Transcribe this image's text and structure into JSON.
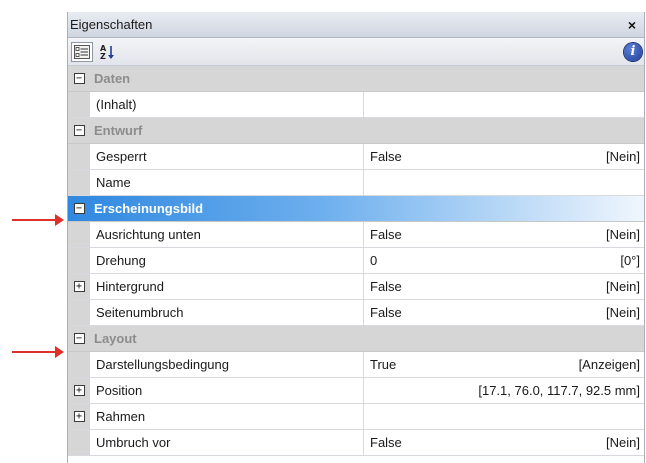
{
  "window": {
    "title": "Eigenschaften",
    "close_symbol": "×"
  },
  "toolbar": {
    "sort_alpha_glyph": "A↓Z",
    "info_glyph": "i"
  },
  "colors": {
    "selected_category": "#2f88e0",
    "arrow": "#e0302c",
    "category_bg": "#d6d6d6"
  },
  "rows": [
    {
      "type": "category",
      "label": "Daten",
      "expander": "−"
    },
    {
      "type": "prop",
      "name": "(Inhalt)",
      "value": "",
      "display": ""
    },
    {
      "type": "category",
      "label": "Entwurf",
      "expander": "−"
    },
    {
      "type": "prop",
      "name": "Gesperrt",
      "value": "False",
      "display": "[Nein]"
    },
    {
      "type": "prop",
      "name": "Name",
      "value": "",
      "display": ""
    },
    {
      "type": "category",
      "label": "Erscheinungsbild",
      "expander": "−",
      "selected": true
    },
    {
      "type": "prop",
      "name": "Ausrichtung unten",
      "value": "False",
      "display": "[Nein]"
    },
    {
      "type": "prop",
      "name": "Drehung",
      "value": "0",
      "display": "[0°]"
    },
    {
      "type": "prop",
      "name": "Hintergrund",
      "value": "False",
      "display": "[Nein]",
      "expander": "+"
    },
    {
      "type": "prop",
      "name": "Seitenumbruch",
      "value": "False",
      "display": "[Nein]"
    },
    {
      "type": "category",
      "label": "Layout",
      "expander": "−"
    },
    {
      "type": "prop",
      "name": "Darstellungsbedingung",
      "value": "True",
      "display": "[Anzeigen]"
    },
    {
      "type": "prop",
      "name": "Position",
      "value": "",
      "display": "[17.1, 76.0, 117.7, 92.5 mm]",
      "expander": "+"
    },
    {
      "type": "prop",
      "name": "Rahmen",
      "value": "",
      "display": "",
      "expander": "+"
    },
    {
      "type": "prop",
      "name": "Umbruch vor",
      "value": "False",
      "display": "[Nein]"
    }
  ]
}
